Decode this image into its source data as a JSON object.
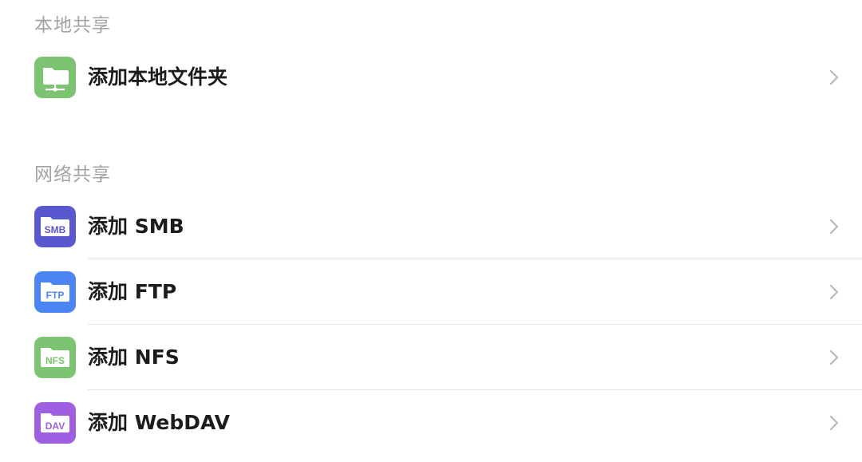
{
  "local_share": {
    "title": "本地共享",
    "items": [
      {
        "label": "添加本地文件夹",
        "icon": "network-folder-icon",
        "color": "#7dc472"
      }
    ]
  },
  "network_share": {
    "title": "网络共享",
    "items": [
      {
        "label": "添加 SMB",
        "icon_text": "SMB",
        "icon": "smb-folder-icon",
        "color": "#5858cf"
      },
      {
        "label": "添加 FTP",
        "icon_text": "FTP",
        "icon": "ftp-folder-icon",
        "color": "#4c84f4"
      },
      {
        "label": "添加 NFS",
        "icon_text": "NFS",
        "icon": "nfs-folder-icon",
        "color": "#7dc472"
      },
      {
        "label": "添加 WebDAV",
        "icon_text": "DAV",
        "icon": "dav-folder-icon",
        "color": "#a05ee0"
      }
    ]
  }
}
